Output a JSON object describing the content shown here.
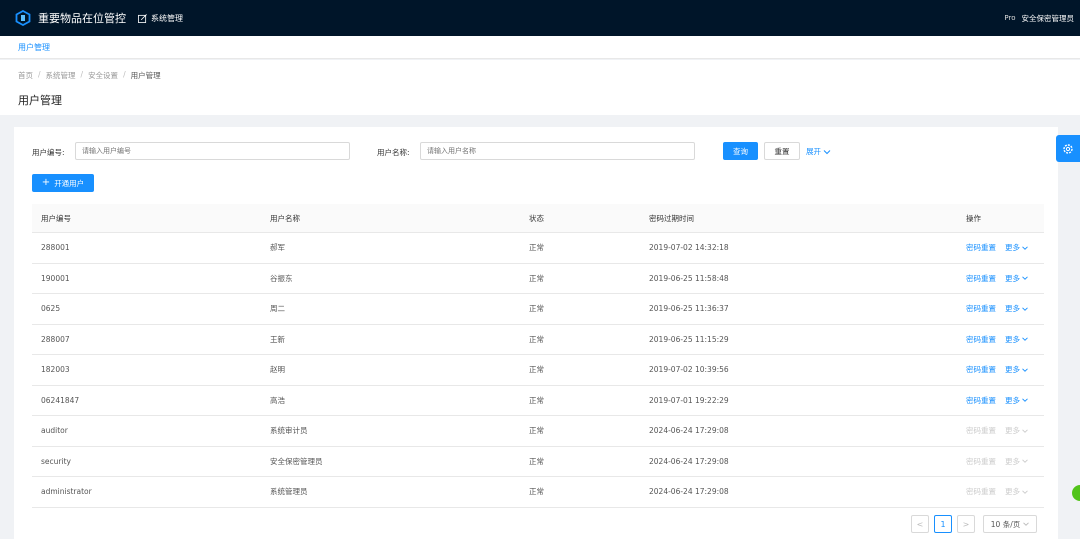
{
  "app": {
    "title": "重要物品在位管控",
    "nav_item": "系统管理"
  },
  "user": {
    "prefix": "Pro",
    "name": "安全保密管理员"
  },
  "tabs": [
    "用户管理"
  ],
  "breadcrumb": [
    "首页",
    "系统管理",
    "安全设置",
    "用户管理"
  ],
  "page_title": "用户管理",
  "search": {
    "user_id_label": "用户编号:",
    "user_id_placeholder": "请输入用户编号",
    "user_name_label": "用户名称:",
    "user_name_placeholder": "请输入用户名称",
    "query_label": "查询",
    "reset_label": "重置",
    "expand_label": "展开"
  },
  "add_user_label": "开通用户",
  "table": {
    "columns": [
      "用户编号",
      "用户名称",
      "状态",
      "密码过期时间",
      "操作"
    ],
    "rows": [
      {
        "id": "288001",
        "name": "郝军",
        "status": "正常",
        "expire": "2019-07-02 14:32:18",
        "enabled": true
      },
      {
        "id": "190001",
        "name": "谷振东",
        "status": "正常",
        "expire": "2019-06-25 11:58:48",
        "enabled": true
      },
      {
        "id": "0625",
        "name": "周二",
        "status": "正常",
        "expire": "2019-06-25 11:36:37",
        "enabled": true
      },
      {
        "id": "288007",
        "name": "王新",
        "status": "正常",
        "expire": "2019-06-25 11:15:29",
        "enabled": true
      },
      {
        "id": "182003",
        "name": "赵明",
        "status": "正常",
        "expire": "2019-07-02 10:39:56",
        "enabled": true
      },
      {
        "id": "06241847",
        "name": "高浩",
        "status": "正常",
        "expire": "2019-07-01 19:22:29",
        "enabled": true
      },
      {
        "id": "auditor",
        "name": "系统审计员",
        "status": "正常",
        "expire": "2024-06-24 17:29:08",
        "enabled": false
      },
      {
        "id": "security",
        "name": "安全保密管理员",
        "status": "正常",
        "expire": "2024-06-24 17:29:08",
        "enabled": false
      },
      {
        "id": "administrator",
        "name": "系统管理员",
        "status": "正常",
        "expire": "2024-06-24 17:29:08",
        "enabled": false
      }
    ],
    "action_reset": "密码重置",
    "action_more": "更多"
  },
  "pagination": {
    "prev": "<",
    "current": "1",
    "next": ">",
    "page_size": "10 条/页"
  },
  "colors": {
    "header_bg": "#001529",
    "primary": "#1890ff",
    "disabled": "#cccccc"
  },
  "icons": [
    "logo-icon",
    "edit-icon",
    "plus-icon",
    "chevron-down-icon",
    "gear-icon"
  ]
}
